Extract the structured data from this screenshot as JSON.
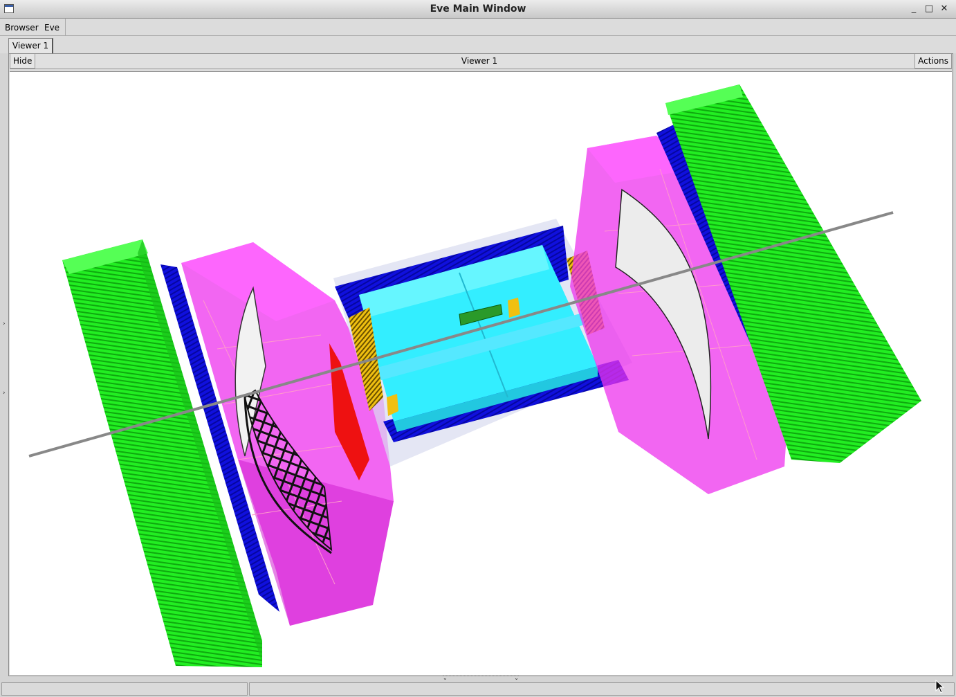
{
  "window": {
    "title": "Eve Main Window",
    "controls": [
      "_",
      "□",
      "✕"
    ]
  },
  "menubar": {
    "items": [
      "Browser",
      "Eve"
    ]
  },
  "tabs": [
    {
      "label": "Viewer 1"
    }
  ],
  "viewer": {
    "hide_label": "Hide",
    "title": "Viewer 1",
    "actions_label": "Actions"
  },
  "colors": {
    "muon_green": "#22ee22",
    "blue": "#1010dd",
    "magenta": "#ee33ee",
    "cyan": "#33eeff",
    "yellow": "#f0c010",
    "red": "#ee1111"
  }
}
